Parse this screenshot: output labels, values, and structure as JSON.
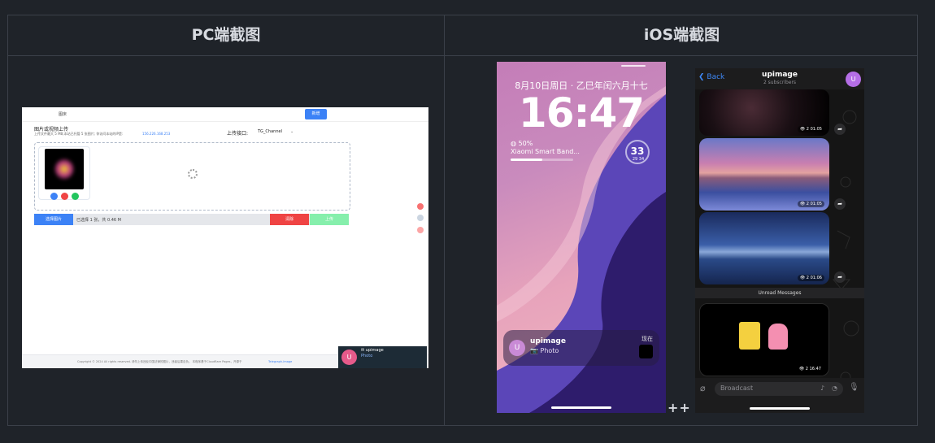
{
  "table": {
    "pc_header": "PC端截图",
    "ios_header": "iOS端截图"
  },
  "pc": {
    "nav_link": "图床",
    "nav_button": "新增",
    "upload_title": "图片或视频上传",
    "upload_hint": "上传文件最大 5 MB;本站已托管 5 张图片; 你访问本站的IP是:",
    "ip": "156.226.168.253",
    "port_label": "上传接口:",
    "port_value": "TG_Channel",
    "select_button": "选择图片",
    "selected_info": "已选择 1 张，共 0.46 M",
    "clear_button": "清除",
    "upload_button": "上传",
    "footer": "Copyright © 2024 All rights reserved. 请勿上传违反中国法律的图片，违者后果自负。 本程序基于Cloudflare Pages，开源于",
    "footer_link": "Telegraph-Image",
    "notif_avatar": "U",
    "notif_title": "✉ upimage",
    "notif_body": "Photo"
  },
  "lock": {
    "date": "8月10日周日 · 乙巳年闰六月十七",
    "time": "16:47",
    "battery": "50%",
    "band": "Xiaomi Smart Band...",
    "band_progress": 0.5,
    "ring_value": "33",
    "ring_range": "29  34",
    "notif_avatar": "U",
    "notif_title": "upimage",
    "notif_body": "📷 Photo",
    "notif_time": "现在"
  },
  "plus_text": "++",
  "telegram": {
    "back": "Back",
    "title": "upimage",
    "subtitle": "2 subscribers",
    "avatar": "U",
    "messages": [
      {
        "meta": "👁 2  01:05"
      },
      {
        "meta": "👁 2  01:05"
      },
      {
        "meta": "👁 2  01:06"
      }
    ],
    "unread": "Unread Messages",
    "last_meta": "👁 2  16:47",
    "input_placeholder": "Broadcast"
  }
}
